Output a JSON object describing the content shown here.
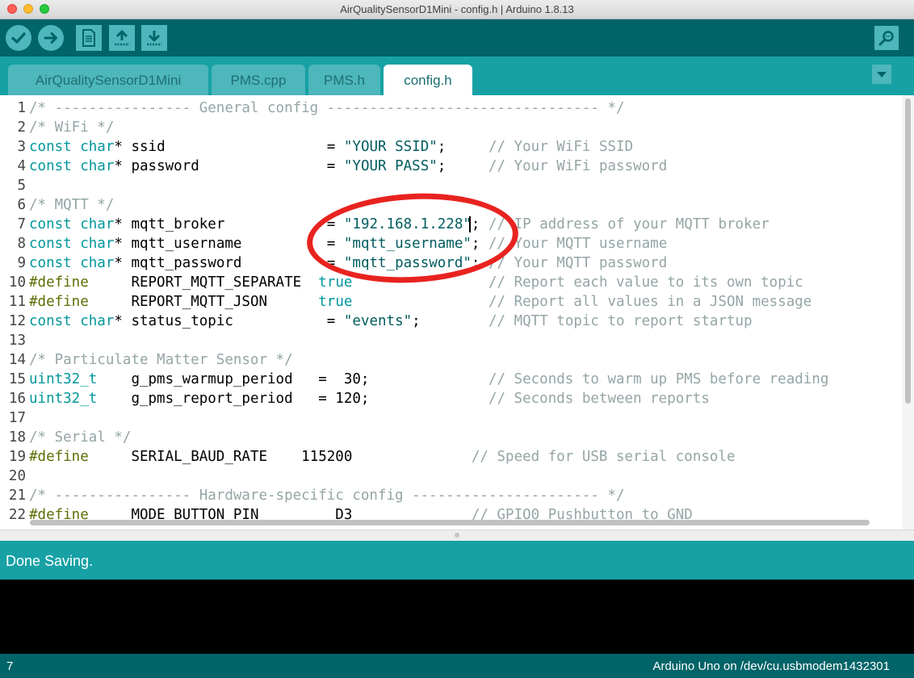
{
  "window": {
    "title": "AirQualitySensorD1Mini - config.h | Arduino 1.8.13",
    "traffic_light_colors": [
      "#ff5f57",
      "#febc2e",
      "#28c840"
    ]
  },
  "toolbar": {
    "buttons": [
      "verify-icon",
      "upload-icon",
      "new-file-icon",
      "open-icon",
      "save-icon"
    ],
    "serial_monitor": "magnifier-icon"
  },
  "tabs": [
    {
      "label": "AirQualitySensorD1Mini",
      "active": false
    },
    {
      "label": "PMS.cpp",
      "active": false
    },
    {
      "label": "PMS.h",
      "active": false
    },
    {
      "label": "config.h",
      "active": true
    }
  ],
  "editor": {
    "lines": [
      {
        "n": "1",
        "code": "/* ---------------- General config -------------------------------- */"
      },
      {
        "n": "2",
        "code": "/* WiFi */"
      },
      {
        "n": "3",
        "code": "const char* ssid                   = \"YOUR SSID\";     // Your WiFi SSID"
      },
      {
        "n": "4",
        "code": "const char* password               = \"YOUR PASS\";     // Your WiFi password"
      },
      {
        "n": "5",
        "code": ""
      },
      {
        "n": "6",
        "code": "/* MQTT */"
      },
      {
        "n": "7",
        "code": "const char* mqtt_broker            = \"192.168.1.228\"; // IP address of your MQTT broker"
      },
      {
        "n": "8",
        "code": "const char* mqtt_username          = \"mqtt_username\"; // Your MQTT username"
      },
      {
        "n": "9",
        "code": "const char* mqtt_password          = \"mqtt_password\"; // Your MQTT password"
      },
      {
        "n": "10",
        "code": "#define     REPORT_MQTT_SEPARATE  true                // Report each value to its own topic"
      },
      {
        "n": "11",
        "code": "#define     REPORT_MQTT_JSON      true                // Report all values in a JSON message"
      },
      {
        "n": "12",
        "code": "const char* status_topic           = \"events\";        // MQTT topic to report startup"
      },
      {
        "n": "13",
        "code": ""
      },
      {
        "n": "14",
        "code": "/* Particulate Matter Sensor */"
      },
      {
        "n": "15",
        "code": "uint32_t    g_pms_warmup_period   =  30;              // Seconds to warm up PMS before reading"
      },
      {
        "n": "16",
        "code": "uint32_t    g_pms_report_period   = 120;              // Seconds between reports"
      },
      {
        "n": "17",
        "code": ""
      },
      {
        "n": "18",
        "code": "/* Serial */"
      },
      {
        "n": "19",
        "code": "#define     SERIAL_BAUD_RATE    115200              // Speed for USB serial console"
      },
      {
        "n": "20",
        "code": ""
      },
      {
        "n": "21",
        "code": "/* ---------------- Hardware-specific config ---------------------- */"
      },
      {
        "n": "22",
        "code": "#define     MODE_BUTTON_PIN         D3              // GPIO0 Pushbutton to GND"
      }
    ],
    "cursor": {
      "line": 7,
      "column": 50
    }
  },
  "status": {
    "message": "Done Saving."
  },
  "footer": {
    "current_line": "7",
    "board": "Arduino Uno on /dev/cu.usbmodem1432301"
  }
}
